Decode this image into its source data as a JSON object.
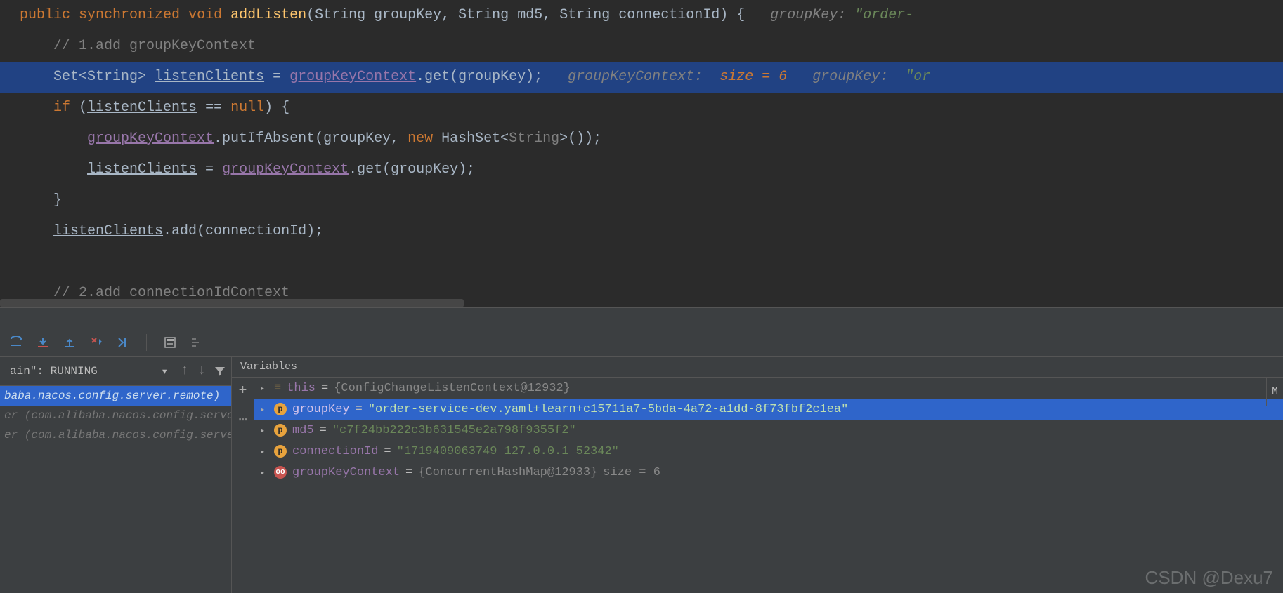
{
  "code": {
    "line1": {
      "pre": "public synchronized void ",
      "method": "addListen",
      "sig": "(String groupKey, String md5, String connectionId) {   ",
      "hint_lbl": "groupKey: ",
      "hint_val": "\"order-"
    },
    "line2": "    // 1.add groupKeyContext",
    "line3": {
      "pre": "    Set<String> ",
      "var": "listenClients",
      "mid": " = ",
      "fld": "groupKeyContext",
      "call": ".get(groupKey);   ",
      "h1": "groupKeyContext:  ",
      "h1v": "size = 6",
      "sp": "   ",
      "h2": "groupKey:  ",
      "h2v": "\"or"
    },
    "line4": {
      "a": "    if (",
      "b": "listenClients",
      "c": " == null) {"
    },
    "line5": {
      "a": "        ",
      "b": "groupKeyContext",
      "c": ".putIfAbsent(groupKey, ",
      "d": "new",
      "e": " HashSet<",
      "f": "String",
      "g": ">());"
    },
    "line6": {
      "a": "        ",
      "b": "listenClients",
      "c": " = ",
      "d": "groupKeyContext",
      "e": ".get(groupKey);"
    },
    "line7": "    }",
    "line8": {
      "a": "    ",
      "b": "listenClients",
      "c": ".add(connectionId);"
    },
    "line9": "",
    "line10": "    // 2.add connectionIdContext"
  },
  "debug": {
    "toolbar_icons": [
      "step-over",
      "step-into",
      "step-out",
      "force-step-into",
      "run-to-cursor",
      "evaluate-expression",
      "trace"
    ],
    "thread_state": "ain\": RUNNING",
    "nav_icons": [
      "prev-frame",
      "next-frame",
      "filter"
    ],
    "stack": [
      {
        "sel": true,
        "text": "baba.nacos.config.server.remote)"
      },
      {
        "sel": false,
        "text": "er (com.alibaba.nacos.config.server.re"
      },
      {
        "sel": false,
        "text": "er (com.alibaba.nacos.config.server.re"
      }
    ],
    "vars_title": "Variables",
    "vars": [
      {
        "sel": false,
        "badge": "th",
        "badge_text": "≡",
        "name": "this",
        "eq": " = ",
        "val": "{ConfigChangeListenContext@12932}",
        "dim": ""
      },
      {
        "sel": true,
        "badge": "p",
        "badge_text": "p",
        "name": "groupKey",
        "eq": " = ",
        "val": "\"order-service-dev.yaml+learn+c15711a7-5bda-4a72-a1dd-8f73fbf2c1ea\"",
        "dim": ""
      },
      {
        "sel": false,
        "badge": "p",
        "badge_text": "p",
        "name": "md5",
        "eq": " = ",
        "val": "\"c7f24bb222c3b631545e2a798f9355f2\"",
        "dim": ""
      },
      {
        "sel": false,
        "badge": "p",
        "badge_text": "p",
        "name": "connectionId",
        "eq": " = ",
        "val": "\"1719409063749_127.0.0.1_52342\"",
        "dim": ""
      },
      {
        "sel": false,
        "badge": "f",
        "badge_text": "oo",
        "name": "groupKeyContext",
        "eq": " = ",
        "val": "{ConcurrentHashMap@12933}",
        "dim": "  size = 6"
      }
    ],
    "side_label": "M",
    "add_icon": "+"
  },
  "watermark": "CSDN @Dexu7"
}
